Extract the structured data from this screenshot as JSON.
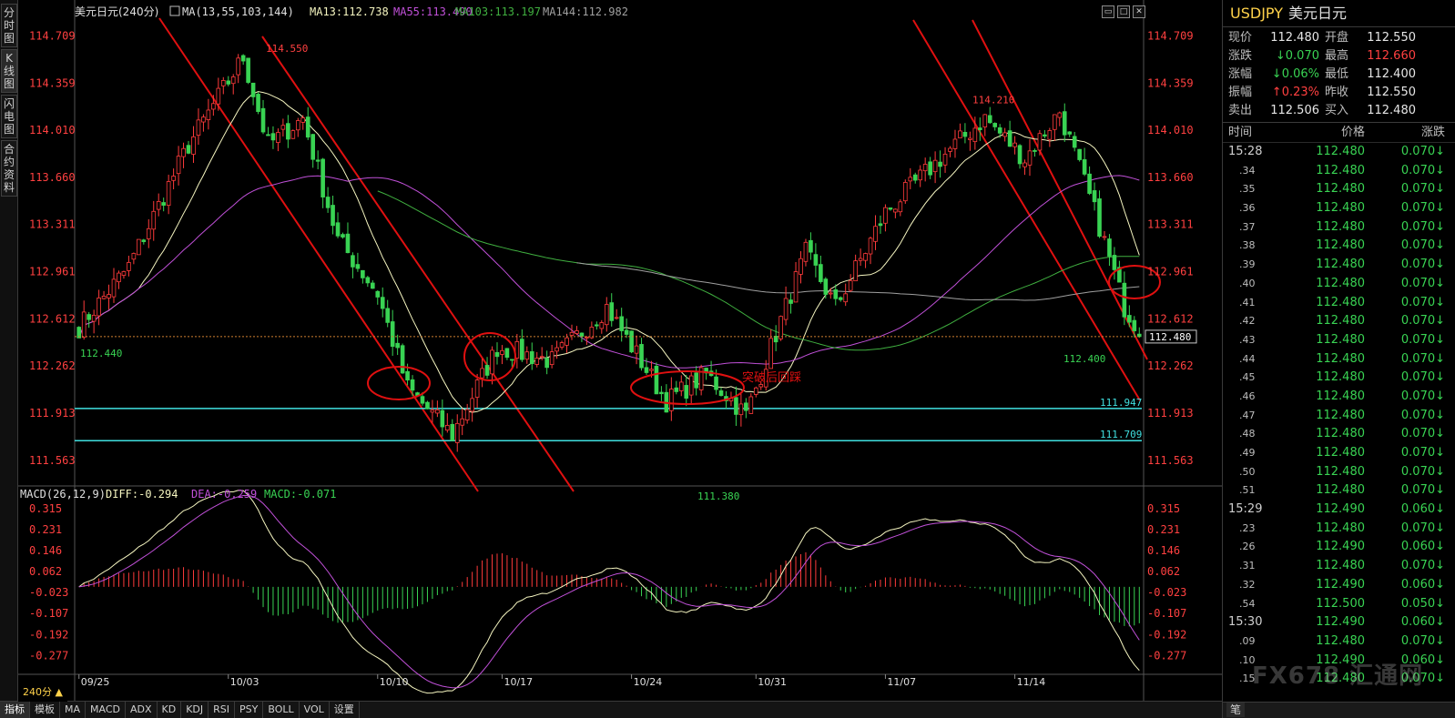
{
  "sidebar": {
    "tabs": [
      {
        "label": "分时图"
      },
      {
        "label": "K线图"
      },
      {
        "label": "闪电图"
      },
      {
        "label": "合约资料"
      }
    ]
  },
  "chart_header": {
    "title": "美元日元(240分)",
    "ma_params": "MA(13,55,103,144)",
    "ma13": "MA13:112.738",
    "ma55": "MA55:113.490",
    "ma103": "MA103:113.197",
    "ma144": "MA144:112.982"
  },
  "macd_header": {
    "params": "MACD(26,12,9)",
    "diff": "DIFF:-0.294",
    "dea": "DEA:-0.259",
    "macd": "MACD:-0.071"
  },
  "colors": {
    "up": "#ff3b3b",
    "down": "#39d353",
    "ma13": "#f5f5c0",
    "ma55": "#c050d8",
    "ma103": "#40b040",
    "ma144": "#a0a0a0",
    "channel": "#e01010",
    "support": "#40e0e0",
    "annotation": "#e01010"
  },
  "chart_data": {
    "type": "candlestick",
    "price_axis": {
      "range": [
        111.4,
        114.8
      ],
      "ticks": [
        114.709,
        114.359,
        114.01,
        113.66,
        113.311,
        112.961,
        112.612,
        112.262,
        111.913,
        111.563
      ]
    },
    "macd_axis": {
      "range": [
        -0.33,
        0.34
      ],
      "ticks": [
        0.315,
        0.231,
        0.146,
        0.062,
        -0.023,
        -0.107,
        -0.192,
        -0.277
      ]
    },
    "x_labels": [
      "09/25",
      "10/03",
      "10/10",
      "10/17",
      "10/24",
      "10/31",
      "11/07",
      "11/14"
    ],
    "x_label_positions_index": [
      0,
      30,
      60,
      85,
      111,
      136,
      162,
      188
    ],
    "period_label": "240分",
    "candle_count": 214,
    "segments": [
      [
        0,
        112.55
      ],
      [
        10,
        113.0
      ],
      [
        22,
        113.9
      ],
      [
        33,
        114.55
      ],
      [
        38,
        113.9
      ],
      [
        45,
        114.1
      ],
      [
        52,
        113.2
      ],
      [
        60,
        112.8
      ],
      [
        66,
        112.1
      ],
      [
        75,
        111.75
      ],
      [
        84,
        112.4
      ],
      [
        95,
        112.3
      ],
      [
        106,
        112.7
      ],
      [
        118,
        112.0
      ],
      [
        126,
        112.2
      ],
      [
        134,
        111.9
      ],
      [
        140,
        112.5
      ],
      [
        146,
        113.1
      ],
      [
        152,
        112.7
      ],
      [
        162,
        113.4
      ],
      [
        173,
        113.8
      ],
      [
        182,
        114.1
      ],
      [
        190,
        113.8
      ],
      [
        197,
        114.15
      ],
      [
        205,
        113.3
      ],
      [
        210,
        112.7
      ],
      [
        214,
        112.48
      ]
    ],
    "current_price": 112.48,
    "annotations": {
      "high_1": 114.55,
      "low_start": 112.44,
      "low_1": 111.38,
      "high_2": 114.21,
      "low_2": 112.4,
      "support_1": 111.947,
      "support_2": 111.709,
      "note": "突破后回踩"
    },
    "series": [
      {
        "name": "MA13",
        "values": []
      },
      {
        "name": "MA55",
        "values": []
      },
      {
        "name": "MA103",
        "values": []
      },
      {
        "name": "MA144",
        "values": []
      },
      {
        "name": "DIFF",
        "values": []
      },
      {
        "name": "DEA",
        "values": []
      },
      {
        "name": "MACD",
        "values": []
      }
    ]
  },
  "quote": {
    "symbol": "USDJPY",
    "name": "美元日元",
    "rows": [
      {
        "l1": "现价",
        "v1": "112.480",
        "c1": "",
        "l2": "开盘",
        "v2": "112.550",
        "c2": ""
      },
      {
        "l1": "涨跌",
        "v1": "↓0.070",
        "c1": "green",
        "l2": "最高",
        "v2": "112.660",
        "c2": "red"
      },
      {
        "l1": "涨幅",
        "v1": "↓0.06%",
        "c1": "green",
        "l2": "最低",
        "v2": "112.400",
        "c2": ""
      },
      {
        "l1": "振幅",
        "v1": "↑0.23%",
        "c1": "red",
        "l2": "昨收",
        "v2": "112.550",
        "c2": ""
      },
      {
        "l1": "卖出",
        "v1": "112.506",
        "c1": "",
        "l2": "买入",
        "v2": "112.480",
        "c2": ""
      }
    ]
  },
  "ticks": {
    "headers": {
      "time": "时间",
      "price": "价格",
      "change": "涨跌"
    },
    "rows": [
      {
        "t": "15:28",
        "p": "112.480",
        "c": "0.070↓",
        "big": true
      },
      {
        "t": ".34",
        "p": "112.480",
        "c": "0.070↓"
      },
      {
        "t": ".35",
        "p": "112.480",
        "c": "0.070↓"
      },
      {
        "t": ".36",
        "p": "112.480",
        "c": "0.070↓"
      },
      {
        "t": ".37",
        "p": "112.480",
        "c": "0.070↓"
      },
      {
        "t": ".38",
        "p": "112.480",
        "c": "0.070↓"
      },
      {
        "t": ".39",
        "p": "112.480",
        "c": "0.070↓"
      },
      {
        "t": ".40",
        "p": "112.480",
        "c": "0.070↓"
      },
      {
        "t": ".41",
        "p": "112.480",
        "c": "0.070↓"
      },
      {
        "t": ".42",
        "p": "112.480",
        "c": "0.070↓"
      },
      {
        "t": ".43",
        "p": "112.480",
        "c": "0.070↓"
      },
      {
        "t": ".44",
        "p": "112.480",
        "c": "0.070↓"
      },
      {
        "t": ".45",
        "p": "112.480",
        "c": "0.070↓"
      },
      {
        "t": ".46",
        "p": "112.480",
        "c": "0.070↓"
      },
      {
        "t": ".47",
        "p": "112.480",
        "c": "0.070↓"
      },
      {
        "t": ".48",
        "p": "112.480",
        "c": "0.070↓"
      },
      {
        "t": ".49",
        "p": "112.480",
        "c": "0.070↓"
      },
      {
        "t": ".50",
        "p": "112.480",
        "c": "0.070↓"
      },
      {
        "t": ".51",
        "p": "112.480",
        "c": "0.070↓"
      },
      {
        "t": "15:29",
        "p": "112.490",
        "c": "0.060↓",
        "big": true
      },
      {
        "t": ".23",
        "p": "112.480",
        "c": "0.070↓"
      },
      {
        "t": ".26",
        "p": "112.490",
        "c": "0.060↓"
      },
      {
        "t": ".31",
        "p": "112.480",
        "c": "0.070↓"
      },
      {
        "t": ".32",
        "p": "112.490",
        "c": "0.060↓"
      },
      {
        "t": ".54",
        "p": "112.500",
        "c": "0.050↓"
      },
      {
        "t": "15:30",
        "p": "112.490",
        "c": "0.060↓",
        "big": true
      },
      {
        "t": ".09",
        "p": "112.480",
        "c": "0.070↓"
      },
      {
        "t": ".10",
        "p": "112.490",
        "c": "0.060↓"
      },
      {
        "t": ".15",
        "p": "112.480",
        "c": "0.070↓"
      }
    ]
  },
  "bottom_tabs": [
    "指标",
    "模板",
    "MA",
    "MACD",
    "ADX",
    "KD",
    "KDJ",
    "RSI",
    "PSY",
    "BOLL",
    "VOL",
    "设置"
  ],
  "right_footer": "笔",
  "watermark": "FX678 汇通网"
}
